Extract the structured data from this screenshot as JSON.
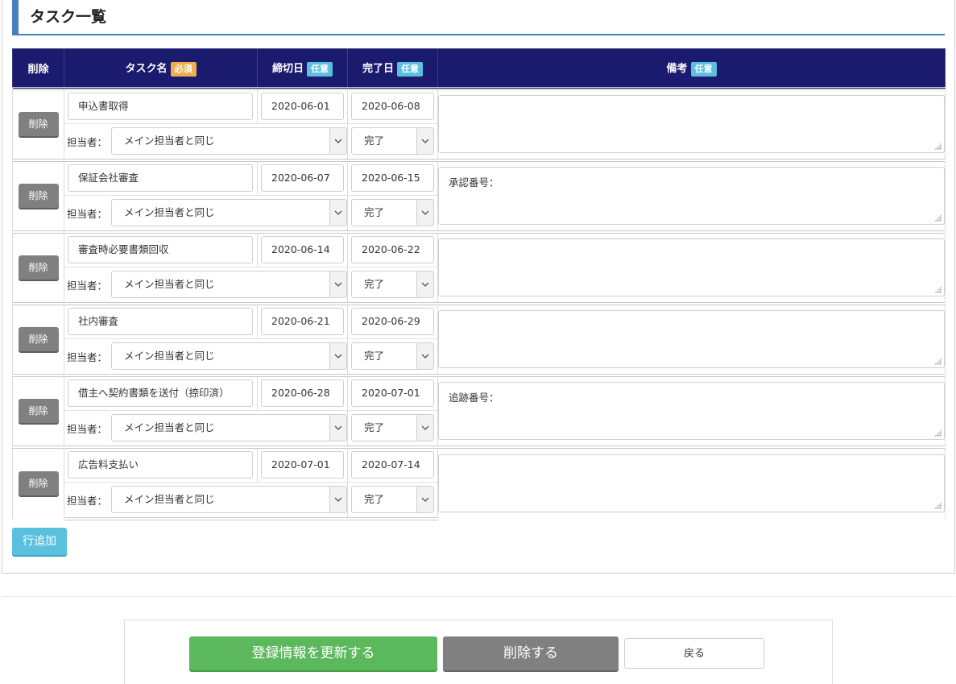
{
  "section_title": "タスク一覧",
  "table": {
    "headers": {
      "delete": "削除",
      "task_name": "タスク名",
      "task_name_badge": "必須",
      "due_date": "締切日",
      "due_date_badge": "任意",
      "done_date": "完了日",
      "done_date_badge": "任意",
      "note": "備考",
      "note_badge": "任意"
    },
    "assignee_label": "担当者：",
    "delete_button_label": "削除",
    "rows": [
      {
        "name": "申込書取得",
        "due": "2020-06-01",
        "done": "2020-06-08",
        "assignee": "メイン担当者と同じ",
        "status": "完了",
        "note": ""
      },
      {
        "name": "保証会社審査",
        "due": "2020-06-07",
        "done": "2020-06-15",
        "assignee": "メイン担当者と同じ",
        "status": "完了",
        "note": "承認番号："
      },
      {
        "name": "審査時必要書類回収",
        "due": "2020-06-14",
        "done": "2020-06-22",
        "assignee": "メイン担当者と同じ",
        "status": "完了",
        "note": ""
      },
      {
        "name": "社内審査",
        "due": "2020-06-21",
        "done": "2020-06-29",
        "assignee": "メイン担当者と同じ",
        "status": "完了",
        "note": ""
      },
      {
        "name": "借主へ契約書類を送付（捺印済）",
        "due": "2020-06-28",
        "done": "2020-07-01",
        "assignee": "メイン担当者と同じ",
        "status": "完了",
        "note": "追跡番号："
      },
      {
        "name": "広告料支払い",
        "due": "2020-07-01",
        "done": "2020-07-14",
        "assignee": "メイン担当者と同じ",
        "status": "完了",
        "note": ""
      }
    ]
  },
  "add_row_label": "行追加",
  "footer": {
    "update_label": "登録情報を更新する",
    "delete_label": "削除する",
    "back_label": "戻る"
  },
  "icons": {
    "select_arrow": "chevron-down-icon",
    "resize_grip": "resize-grip-icon"
  },
  "colors": {
    "header_bg": "#1a1a6e",
    "required_badge": "#f0ad4e",
    "optional_badge": "#5bc0de",
    "update_button": "#5cb85c",
    "delete_button": "#808080",
    "title_accent": "#4a7fb9"
  }
}
